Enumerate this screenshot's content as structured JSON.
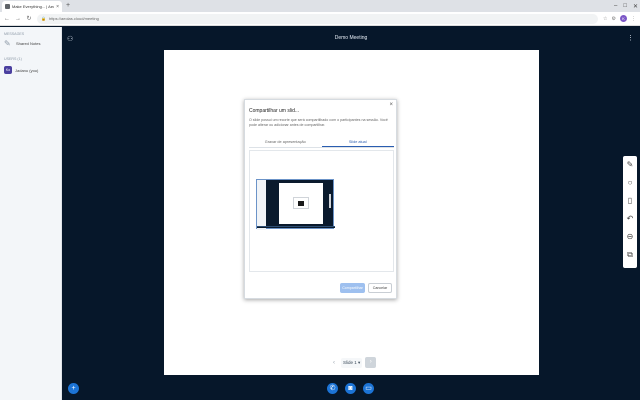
{
  "browser": {
    "tab_title": "Make Everything... | Aeolas.co...",
    "url": "https://aeolas.cloud/meeting",
    "new_tab_symbol": "+",
    "window_controls": [
      "–",
      "□",
      "✕"
    ],
    "profile_initial": "K"
  },
  "sidebar": {
    "notes_heading": "MESSAGES",
    "shared_notes_label": "Shared Notes",
    "users_heading": "USERS (1)",
    "user": {
      "initials": "Ko",
      "name": "Jadanu (you)"
    }
  },
  "header": {
    "title": "Demo Meeting"
  },
  "dialog": {
    "title": "Compartilhar um slid...",
    "description": "O slide possui um recorte que será compartilhado com o participantes na sessão. Você pode alterar ou adicionar antes de compartilhar.",
    "tabs": [
      {
        "label": "Gravar de apresentação",
        "active": false
      },
      {
        "label": "Slide atual",
        "active": true
      }
    ],
    "share_label": "Compartilhar",
    "cancel_label": "Cancelar"
  },
  "pager": {
    "label": "Slide 1 ▾"
  },
  "colors": {
    "accent": "#1c74d6",
    "background": "#06172a",
    "share_button": "#9ec0ef"
  }
}
